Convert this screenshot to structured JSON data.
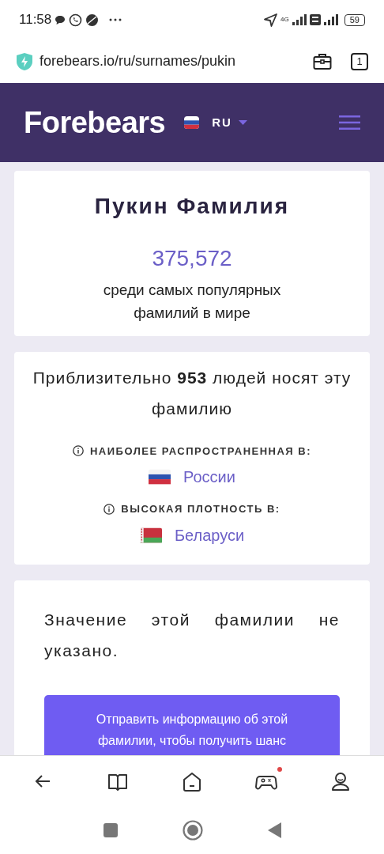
{
  "status_bar": {
    "time": "11:58",
    "network": "4G",
    "battery": "59"
  },
  "browser": {
    "url": "forebears.io/ru/surnames/pukin",
    "tab_count": "1"
  },
  "header": {
    "logo": "Forebears",
    "language": "RU"
  },
  "surname_card": {
    "title": "Пукин Фамилия",
    "rank": "375,572",
    "rank_caption": "среди самых популярных фамилий в мире"
  },
  "count_card": {
    "text": "Приблизительно **953** людей носят эту фамилию",
    "stats": [
      {
        "label": "НАИБОЛЕЕ РАСПРОСТРАНЕННАЯ В:",
        "country": "России"
      },
      {
        "label": "ВЫСОКАЯ ПЛОТНОСТЬ В:",
        "country": "Беларуси"
      }
    ]
  },
  "meaning_card": {
    "text": "Значение этой фамилии не указано.",
    "button": "Отправить информацию об этой фамилии, чтобы получить шанс"
  },
  "bottom_nav": [
    {
      "kind": "back",
      "notification": false
    },
    {
      "kind": "book",
      "notification": false
    },
    {
      "kind": "home",
      "notification": false
    },
    {
      "kind": "games",
      "notification": true
    },
    {
      "kind": "profile",
      "notification": false
    }
  ]
}
